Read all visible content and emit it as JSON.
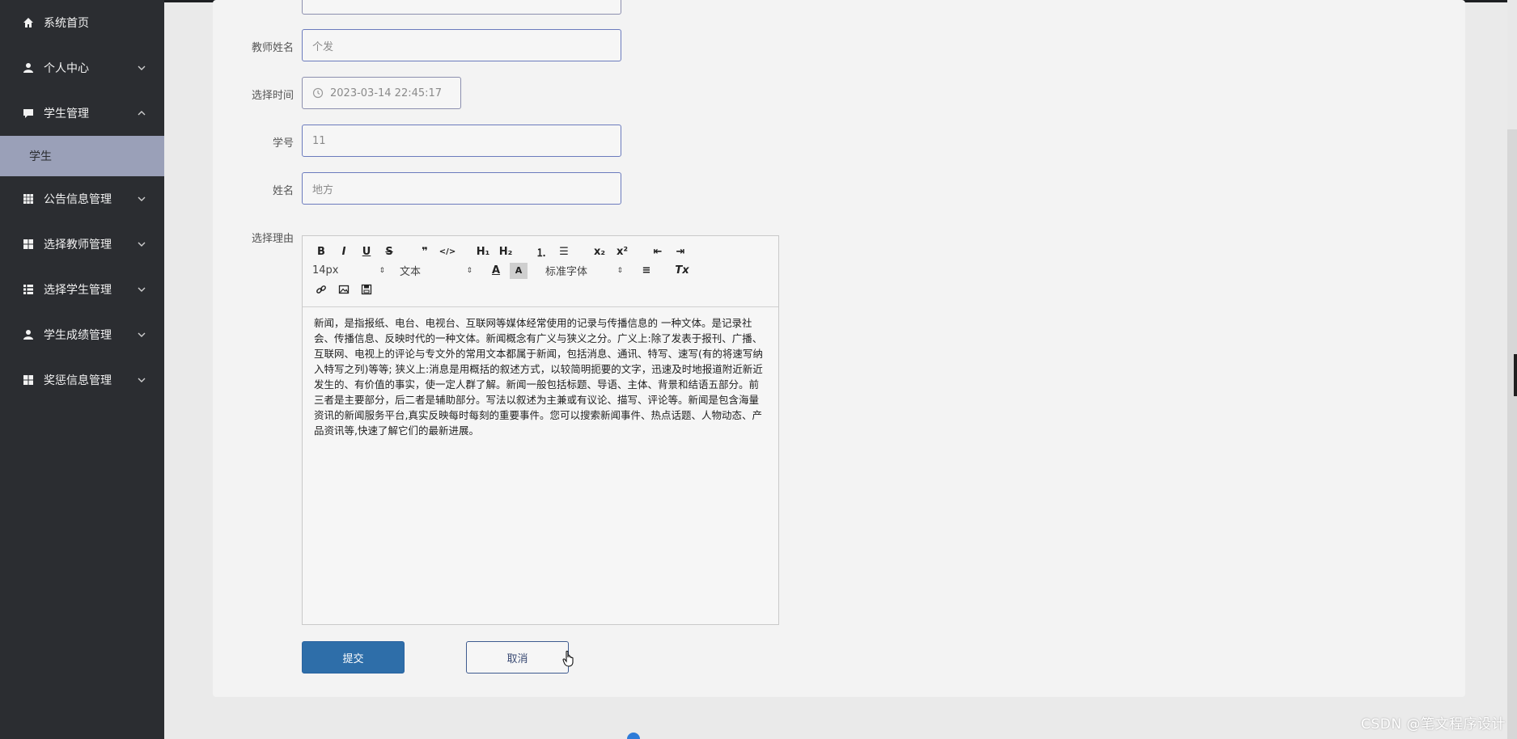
{
  "sidebar": {
    "items": [
      {
        "label": "系统首页",
        "icon": "home-icon"
      },
      {
        "label": "个人中心",
        "icon": "user-icon"
      },
      {
        "label": "学生管理",
        "icon": "chat-icon",
        "expanded": true
      },
      {
        "label": "公告信息管理",
        "icon": "grid-icon"
      },
      {
        "label": "选择教师管理",
        "icon": "grid-icon"
      },
      {
        "label": "选择学生管理",
        "icon": "list-icon"
      },
      {
        "label": "学生成绩管理",
        "icon": "user-icon"
      },
      {
        "label": "奖惩信息管理",
        "icon": "grid-icon"
      }
    ],
    "sub_item": "学生"
  },
  "form": {
    "teacher_name_label": "教师姓名",
    "teacher_name_value": "个发",
    "select_time_label": "选择时间",
    "select_time_value": "2023-03-14 22:45:17",
    "student_no_label": "学号",
    "student_no_value": "11",
    "name_label": "姓名",
    "name_value": "地方",
    "reason_label": "选择理由"
  },
  "editor": {
    "toolbar": {
      "bold": "B",
      "italic": "I",
      "underline": "U",
      "strike": "S",
      "quote": "❞",
      "code": "</>",
      "h1": "H₁",
      "h2": "H₂",
      "ordered_list": "⒈",
      "bullet_list": "☰",
      "subscript": "x₂",
      "superscript": "x²",
      "outdent": "⇤",
      "indent": "⇥",
      "size_select": "14px",
      "header_select": "文本",
      "font_select": "标准字体",
      "color": "A",
      "background": "A",
      "align": "≡",
      "clean": "Tx"
    },
    "content": "新闻，是指报纸、电台、电视台、互联网等媒体经常使用的记录与传播信息的 一种文体。是记录社会、传播信息、反映时代的一种文体。新闻概念有广义与狭义之分。广义上:除了发表于报刊、广播、互联网、电视上的评论与专文外的常用文本都属于新闻，包括消息、通讯、特写、速写(有的将速写纳入特写之列)等等; 狭义上:消息是用概括的叙述方式，以较简明扼要的文字，迅速及时地报道附近新近发生的、有价值的事实，使一定人群了解。新闻一般包括标题、导语、主体、背景和结语五部分。前三者是主要部分，后二者是辅助部分。写法以叙述为主兼或有议论、描写、评论等。新闻是包含海量资讯的新闻服务平台,真实反映每时每刻的重要事件。您可以搜索新闻事件、热点话题、人物动态、产品资讯等,快速了解它们的最新进展。"
  },
  "buttons": {
    "submit": "提交",
    "cancel": "取消"
  },
  "watermark": "CSDN @笔文程序设计",
  "colors": {
    "sidebar_bg": "#2b2d31",
    "sub_item_bg": "#9aa0b8",
    "primary": "#2e6ea9",
    "input_border": "#6b7bbd"
  }
}
